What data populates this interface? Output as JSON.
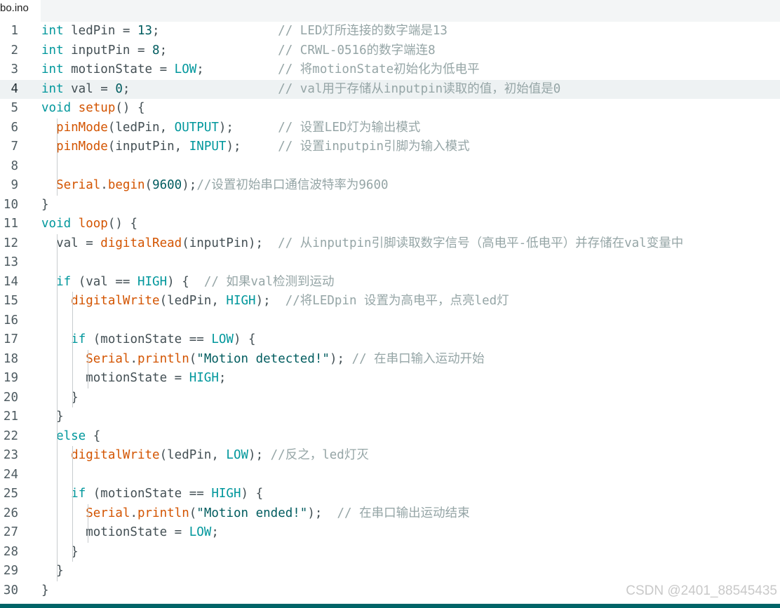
{
  "tab": {
    "filename": "bo.ino"
  },
  "colors": {
    "keyword": "#00979c",
    "function": "#d35400",
    "string": "#005c5f",
    "comment": "#95a5a6",
    "plain": "#434f54",
    "statusbar": "#006468"
  },
  "current_line": 4,
  "lines": [
    {
      "n": "1",
      "tokens": [
        [
          "typ",
          "int"
        ],
        [
          "pl",
          " ledPin = "
        ],
        [
          "num",
          "13"
        ],
        [
          "pl",
          ";                "
        ],
        [
          "cm",
          "// LED灯所连接的数字端是13"
        ]
      ]
    },
    {
      "n": "2",
      "tokens": [
        [
          "typ",
          "int"
        ],
        [
          "pl",
          " inputPin = "
        ],
        [
          "num",
          "8"
        ],
        [
          "pl",
          ";               "
        ],
        [
          "cm",
          "// CRWL-0516的数字端连8"
        ]
      ]
    },
    {
      "n": "3",
      "tokens": [
        [
          "typ",
          "int"
        ],
        [
          "pl",
          " motionState = "
        ],
        [
          "cst",
          "LOW"
        ],
        [
          "pl",
          ";          "
        ],
        [
          "cm",
          "// 将motionState初始化为低电平"
        ]
      ]
    },
    {
      "n": "4",
      "tokens": [
        [
          "typ",
          "int"
        ],
        [
          "pl",
          " val = "
        ],
        [
          "num",
          "0"
        ],
        [
          "pl",
          ";                    "
        ],
        [
          "cm",
          "// val用于存储从inputpin读取的值，初始值是0"
        ]
      ]
    },
    {
      "n": "5",
      "tokens": [
        [
          "typ",
          "void"
        ],
        [
          "pl",
          " "
        ],
        [
          "fn",
          "setup"
        ],
        [
          "pl",
          "() {"
        ]
      ]
    },
    {
      "n": "6",
      "tokens": [
        [
          "pl",
          "  "
        ],
        [
          "fn",
          "pinMode"
        ],
        [
          "pl",
          "(ledPin, "
        ],
        [
          "cst",
          "OUTPUT"
        ],
        [
          "pl",
          ");      "
        ],
        [
          "cm",
          "// 设置LED灯为输出模式"
        ]
      ]
    },
    {
      "n": "7",
      "tokens": [
        [
          "pl",
          "  "
        ],
        [
          "fn",
          "pinMode"
        ],
        [
          "pl",
          "(inputPin, "
        ],
        [
          "cst",
          "INPUT"
        ],
        [
          "pl",
          ");     "
        ],
        [
          "cm",
          "// 设置inputpin引脚为输入模式"
        ]
      ]
    },
    {
      "n": "8",
      "tokens": []
    },
    {
      "n": "9",
      "tokens": [
        [
          "pl",
          "  "
        ],
        [
          "fn",
          "Serial"
        ],
        [
          "pl",
          "."
        ],
        [
          "fn",
          "begin"
        ],
        [
          "pl",
          "("
        ],
        [
          "num",
          "9600"
        ],
        [
          "pl",
          ");"
        ],
        [
          "cm",
          "//设置初始串口通信波特率为9600"
        ]
      ]
    },
    {
      "n": "10",
      "tokens": [
        [
          "pl",
          "}"
        ]
      ]
    },
    {
      "n": "11",
      "tokens": [
        [
          "typ",
          "void"
        ],
        [
          "pl",
          " "
        ],
        [
          "fn",
          "loop"
        ],
        [
          "pl",
          "() {"
        ]
      ]
    },
    {
      "n": "12",
      "tokens": [
        [
          "pl",
          "  val = "
        ],
        [
          "fn",
          "digitalRead"
        ],
        [
          "pl",
          "(inputPin);  "
        ],
        [
          "cm",
          "// 从inputpin引脚读取数字信号（高电平-低电平）并存储在val变量中"
        ]
      ]
    },
    {
      "n": "13",
      "tokens": []
    },
    {
      "n": "14",
      "tokens": [
        [
          "pl",
          "  "
        ],
        [
          "kw",
          "if"
        ],
        [
          "pl",
          " (val == "
        ],
        [
          "cst",
          "HIGH"
        ],
        [
          "pl",
          ") {  "
        ],
        [
          "cm",
          "// 如果val检测到运动"
        ]
      ]
    },
    {
      "n": "15",
      "tokens": [
        [
          "pl",
          "    "
        ],
        [
          "fn",
          "digitalWrite"
        ],
        [
          "pl",
          "(ledPin, "
        ],
        [
          "cst",
          "HIGH"
        ],
        [
          "pl",
          ");  "
        ],
        [
          "cm",
          "//将LEDpin 设置为高电平，点亮led灯"
        ]
      ]
    },
    {
      "n": "16",
      "tokens": []
    },
    {
      "n": "17",
      "tokens": [
        [
          "pl",
          "    "
        ],
        [
          "kw",
          "if"
        ],
        [
          "pl",
          " (motionState == "
        ],
        [
          "cst",
          "LOW"
        ],
        [
          "pl",
          ") {"
        ]
      ]
    },
    {
      "n": "18",
      "tokens": [
        [
          "pl",
          "      "
        ],
        [
          "fn",
          "Serial"
        ],
        [
          "pl",
          "."
        ],
        [
          "fn",
          "println"
        ],
        [
          "pl",
          "("
        ],
        [
          "str",
          "\"Motion detected!\""
        ],
        [
          "pl",
          "); "
        ],
        [
          "cm",
          "// 在串口输入运动开始"
        ]
      ]
    },
    {
      "n": "19",
      "tokens": [
        [
          "pl",
          "      motionState = "
        ],
        [
          "cst",
          "HIGH"
        ],
        [
          "pl",
          ";"
        ]
      ]
    },
    {
      "n": "20",
      "tokens": [
        [
          "pl",
          "    }"
        ]
      ]
    },
    {
      "n": "21",
      "tokens": [
        [
          "pl",
          "  }"
        ]
      ]
    },
    {
      "n": "22",
      "tokens": [
        [
          "pl",
          "  "
        ],
        [
          "kw",
          "else"
        ],
        [
          "pl",
          " {"
        ]
      ]
    },
    {
      "n": "23",
      "tokens": [
        [
          "pl",
          "    "
        ],
        [
          "fn",
          "digitalWrite"
        ],
        [
          "pl",
          "(ledPin, "
        ],
        [
          "cst",
          "LOW"
        ],
        [
          "pl",
          "); "
        ],
        [
          "cm",
          "//反之，led灯灭"
        ]
      ]
    },
    {
      "n": "24",
      "tokens": []
    },
    {
      "n": "25",
      "tokens": [
        [
          "pl",
          "    "
        ],
        [
          "kw",
          "if"
        ],
        [
          "pl",
          " (motionState == "
        ],
        [
          "cst",
          "HIGH"
        ],
        [
          "pl",
          ") {"
        ]
      ]
    },
    {
      "n": "26",
      "tokens": [
        [
          "pl",
          "      "
        ],
        [
          "fn",
          "Serial"
        ],
        [
          "pl",
          "."
        ],
        [
          "fn",
          "println"
        ],
        [
          "pl",
          "("
        ],
        [
          "str",
          "\"Motion ended!\""
        ],
        [
          "pl",
          ");  "
        ],
        [
          "cm",
          "// 在串口输出运动结束"
        ]
      ]
    },
    {
      "n": "27",
      "tokens": [
        [
          "pl",
          "      motionState = "
        ],
        [
          "cst",
          "LOW"
        ],
        [
          "pl",
          ";"
        ]
      ]
    },
    {
      "n": "28",
      "tokens": [
        [
          "pl",
          "    }"
        ]
      ]
    },
    {
      "n": "29",
      "tokens": [
        [
          "pl",
          "  }"
        ]
      ]
    },
    {
      "n": "30",
      "tokens": [
        [
          "pl",
          "}"
        ]
      ]
    }
  ],
  "watermark": "CSDN @2401_88545435"
}
